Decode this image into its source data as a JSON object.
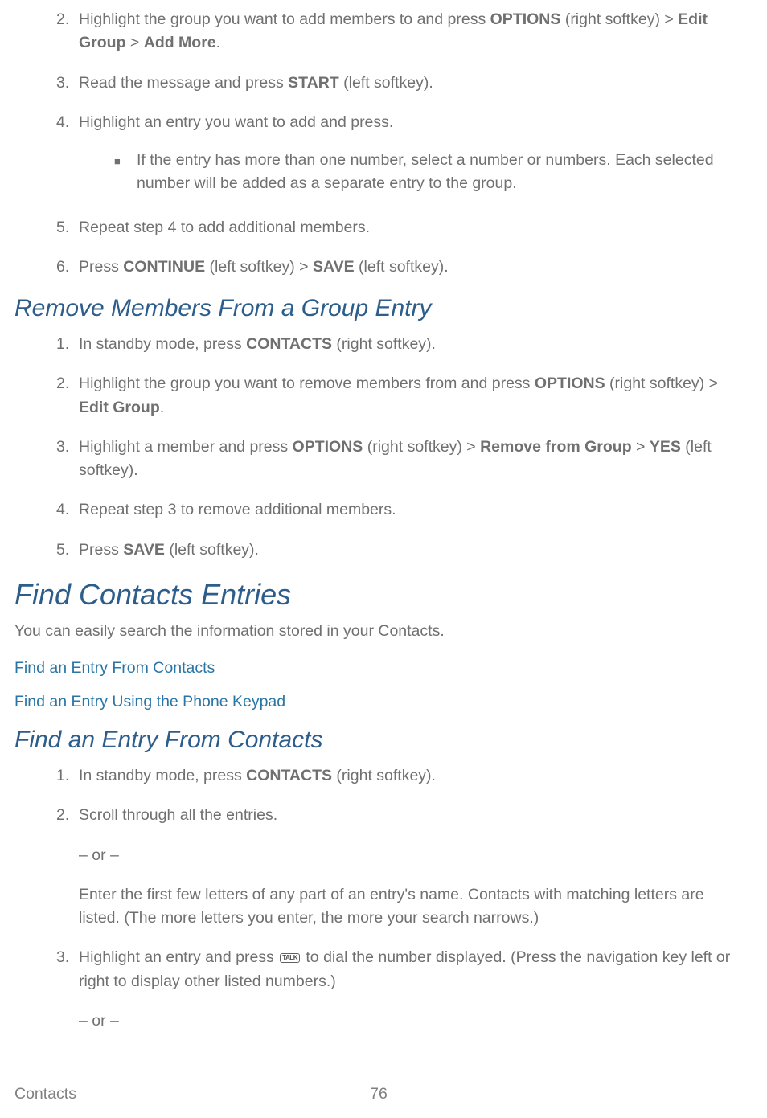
{
  "steps_a": [
    {
      "marker": "2.",
      "segments": [
        {
          "t": "Highlight the group you want to add members to and  press "
        },
        {
          "t": "OPTIONS",
          "b": true
        },
        {
          "t": " (right softkey) > "
        },
        {
          "t": "Edit Group",
          "b": true
        },
        {
          "t": " > "
        },
        {
          "t": "Add More",
          "b": true
        },
        {
          "t": "."
        }
      ],
      "bullets": []
    },
    {
      "marker": "3.",
      "segments": [
        {
          "t": "Read the message and press "
        },
        {
          "t": "START",
          "b": true
        },
        {
          "t": " (left softkey)."
        }
      ],
      "bullets": []
    },
    {
      "marker": "4.",
      "segments": [
        {
          "t": "Highlight an entry you want to add and press."
        }
      ],
      "bullets": [
        {
          "segments": [
            {
              "t": "If the entry has more than one number, select a number or numbers. Each selected number will be added as a separate entry to the group."
            }
          ]
        }
      ]
    },
    {
      "marker": "5.",
      "segments": [
        {
          "t": "Repeat step 4 to add additional members."
        }
      ],
      "bullets": []
    },
    {
      "marker": "6.",
      "segments": [
        {
          "t": "Press "
        },
        {
          "t": "CONTINUE",
          "b": true
        },
        {
          "t": " (left softkey) > "
        },
        {
          "t": "SAVE",
          "b": true
        },
        {
          "t": " (left softkey)."
        }
      ],
      "bullets": []
    }
  ],
  "heading_remove": "Remove Members From a Group Entry",
  "steps_b": [
    {
      "marker": "1.",
      "segments": [
        {
          "t": "In standby mode, press "
        },
        {
          "t": "CONTACTS",
          "b": true
        },
        {
          "t": " (right softkey)."
        }
      ]
    },
    {
      "marker": "2.",
      "segments": [
        {
          "t": "Highlight the group you want to remove members from and press "
        },
        {
          "t": "OPTIONS",
          "b": true
        },
        {
          "t": " (right softkey) > "
        },
        {
          "t": "Edit Group",
          "b": true
        },
        {
          "t": "."
        }
      ]
    },
    {
      "marker": "3.",
      "segments": [
        {
          "t": "Highlight a member and press "
        },
        {
          "t": "OPTIONS",
          "b": true
        },
        {
          "t": " (right softkey) > "
        },
        {
          "t": "Remove from Group",
          "b": true
        },
        {
          "t": " > "
        },
        {
          "t": "YES",
          "b": true
        },
        {
          "t": " (left softkey)."
        }
      ]
    },
    {
      "marker": "4.",
      "segments": [
        {
          "t": "Repeat step 3 to remove additional members."
        }
      ]
    },
    {
      "marker": "5.",
      "segments": [
        {
          "t": "Press "
        },
        {
          "t": "SAVE",
          "b": true
        },
        {
          "t": " (left softkey)."
        }
      ]
    }
  ],
  "heading_find": "Find Contacts Entries",
  "find_intro": "You can easily search the information stored in your Contacts.",
  "link1": "Find an Entry From Contacts",
  "link2": "Find an Entry Using the Phone Keypad",
  "heading_find_entry": "Find an Entry From Contacts",
  "steps_c": [
    {
      "marker": "1.",
      "segments": [
        {
          "t": "In standby mode, press "
        },
        {
          "t": "CONTACTS",
          "b": true
        },
        {
          "t": " (right softkey)."
        }
      ]
    },
    {
      "marker": "2.",
      "segments": [
        {
          "t": "Scroll through all the entries."
        }
      ]
    }
  ],
  "or_text": "– or –",
  "enter_letters": "Enter the first few letters of any part of an entry's name. Contacts with matching letters are listed. (The more letters you enter, the more your search narrows.)",
  "steps_d": [
    {
      "marker": "3.",
      "segments": [
        {
          "t": "Highlight an entry and press "
        },
        {
          "icon": "talk"
        },
        {
          "t": " to dial the number displayed. (Press the navigation key left or right to display other listed numbers.)"
        }
      ]
    }
  ],
  "footer_left": "Contacts",
  "footer_page": "76"
}
